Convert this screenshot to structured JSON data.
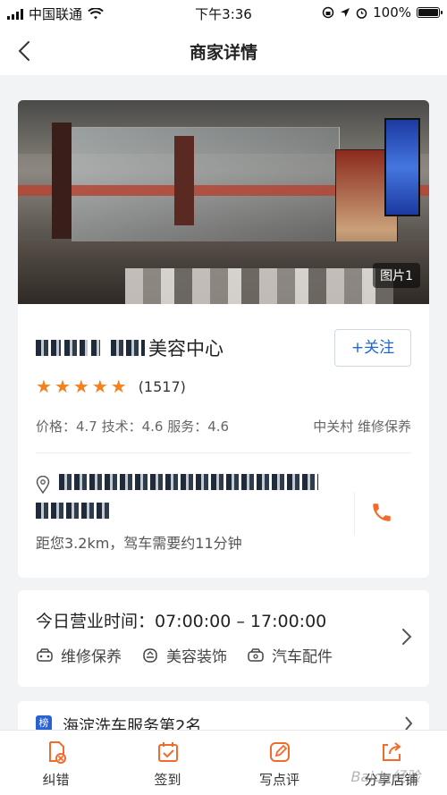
{
  "status_bar": {
    "carrier": "中国联通",
    "time": "下午3:36",
    "battery": "100%"
  },
  "nav": {
    "title": "商家详情"
  },
  "photo": {
    "tag": "图片1"
  },
  "shop": {
    "name_suffix": "美容中心",
    "follow_label": "+关注",
    "rating_count": "(1517)",
    "rating_stars": 5,
    "scores": "价格：4.7  技术：4.6  服务：4.6",
    "area_tags": "中关村  维修保养",
    "distance": "距您3.2km，驾车需要约11分钟"
  },
  "hours": {
    "text": "今日营业时间：07:00:00 – 17:00:00",
    "services": [
      "维修保养",
      "美容装饰",
      "汽车配件"
    ]
  },
  "rank": {
    "badge": "榜",
    "text": "海淀洗车服务第2名"
  },
  "tabs": [
    {
      "label": "纠错",
      "icon": "correction-icon"
    },
    {
      "label": "签到",
      "icon": "checkin-icon"
    },
    {
      "label": "写点评",
      "icon": "write-review-icon"
    },
    {
      "label": "分享店铺",
      "icon": "share-icon"
    }
  ],
  "watermark": "Baidu经验",
  "colors": {
    "accent": "#1d66d6",
    "star": "#f5801e",
    "phone": "#f26b2a"
  }
}
